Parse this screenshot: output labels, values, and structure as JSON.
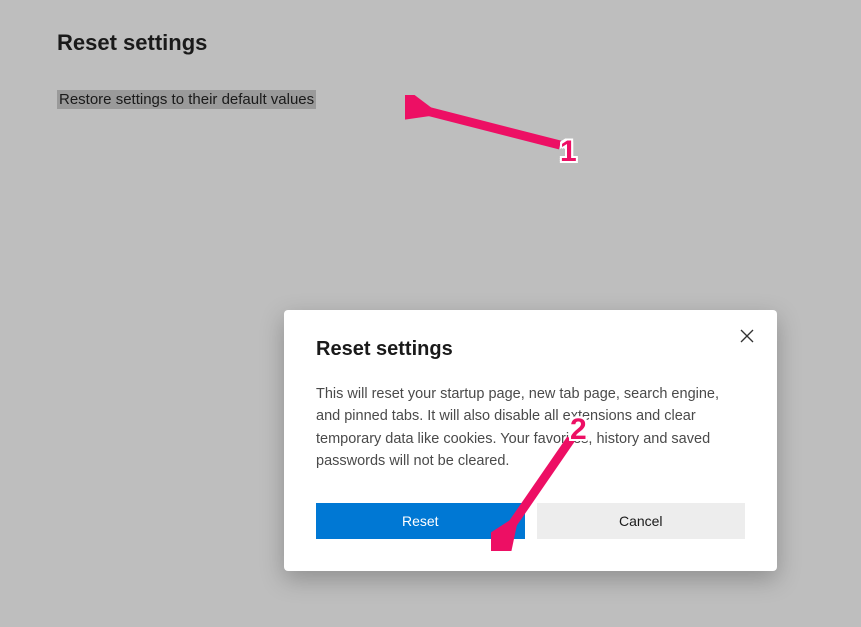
{
  "page": {
    "title": "Reset settings",
    "restore_link": "Restore settings to their default values"
  },
  "dialog": {
    "title": "Reset settings",
    "body": "This will reset your startup page, new tab page, search engine, and pinned tabs. It will also disable all extensions and clear temporary data like cookies. Your favorites, history and saved passwords will not be cleared.",
    "reset_label": "Reset",
    "cancel_label": "Cancel"
  },
  "annotations": {
    "step1": "1",
    "step2": "2"
  }
}
